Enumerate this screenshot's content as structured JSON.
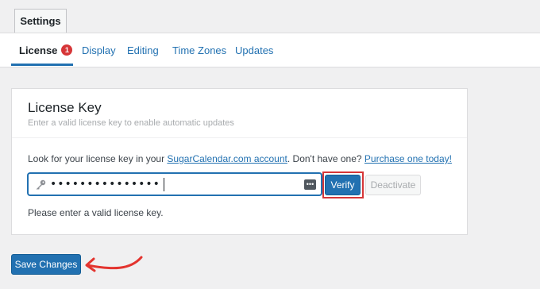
{
  "header": {
    "settings_tab": "Settings"
  },
  "subnav": {
    "tabs": [
      {
        "label": "License",
        "badge": "1"
      },
      {
        "label": "Display"
      },
      {
        "label": "Editing"
      },
      {
        "label": "Time Zones"
      },
      {
        "label": "Updates"
      }
    ]
  },
  "license": {
    "title": "License Key",
    "subtitle": "Enter a valid license key to enable automatic updates",
    "help_prefix": "Look for your license key in your ",
    "help_link1": "SugarCalendar.com account",
    "help_middle": ". Don't have one? ",
    "help_link2": "Purchase one today!",
    "key_value": "•••••••••••••••",
    "key_icon": "key-icon",
    "password_icon": "password-manager-icon",
    "verify_label": "Verify",
    "deactivate_label": "Deactivate",
    "status_message": "Please enter a valid license key."
  },
  "footer": {
    "save_label": "Save Changes"
  },
  "colors": {
    "accent": "#2271b1",
    "highlight": "#d63638",
    "badge": "#d63638"
  }
}
